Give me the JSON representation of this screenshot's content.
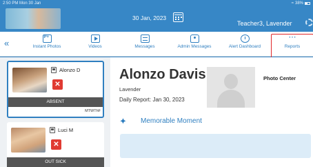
{
  "status_bar": {
    "time": "2:50 PM  Mon 30 Jan",
    "battery": "38%"
  },
  "header": {
    "date": "30 Jan, 2023",
    "teacher": "Teacher3, Lavender"
  },
  "toolbar": {
    "items": [
      {
        "label": "Instant Photos",
        "icon": "instant-photo-icon"
      },
      {
        "label": "Videos",
        "icon": "video-icon"
      },
      {
        "label": "Messages",
        "icon": "message-icon"
      },
      {
        "label": "Admin Messages",
        "icon": "admin-message-icon"
      },
      {
        "label": "Alert Dashboard",
        "icon": "alarm-clock-icon"
      },
      {
        "label": "Reports",
        "icon": "more-dots-icon"
      }
    ],
    "highlight_color": "#e02628"
  },
  "sidebar": {
    "children": [
      {
        "name": "Alonzo D",
        "status": "ABSENT",
        "days": "MTWThF"
      },
      {
        "name": "Luci M",
        "status": "OUT SICK"
      }
    ]
  },
  "main": {
    "child_name": "Alonzo Davis",
    "classroom": "Lavender",
    "daily_report": "Daily Report: Jan 30, 2023",
    "photo_center": "Photo Center",
    "memorable_moment": "Memorable Moment"
  },
  "colors": {
    "brand_blue": "#2f7fc0",
    "absent_red": "#e03b32",
    "status_grey": "#555555"
  }
}
